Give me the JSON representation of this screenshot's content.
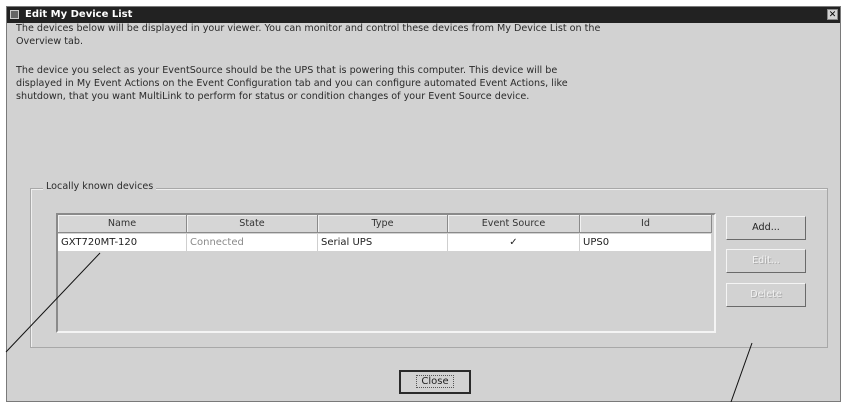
{
  "window": {
    "title": "Edit My Device List",
    "close_glyph": "✕"
  },
  "intro": {
    "line1": "The devices below will be displayed in your viewer. You can monitor and control these devices from My Device List on the",
    "line2": "Overview tab.",
    "line3": "The device you select as your EventSource should be the UPS that is powering this computer. This device will be",
    "line4": "displayed in My Event Actions on the Event Configuration tab and you can configure automated Event Actions, like",
    "line5": "shutdown, that you want MultiLink to perform for status or condition changes of your Event Source device."
  },
  "devices_group": {
    "label": "Locally known devices",
    "columns": [
      "Name",
      "State",
      "Type",
      "Event Source",
      "Id"
    ],
    "rows": [
      {
        "name": "GXT720MT-120",
        "state": "Connected",
        "type": "Serial UPS",
        "event_source": "✓",
        "id": "UPS0"
      }
    ]
  },
  "buttons": {
    "add": "Add...",
    "edit": "Edit...",
    "delete": "Delete",
    "close": "Close"
  },
  "icons": {
    "window_icon": "app-window-icon",
    "check": "checkmark-icon"
  }
}
